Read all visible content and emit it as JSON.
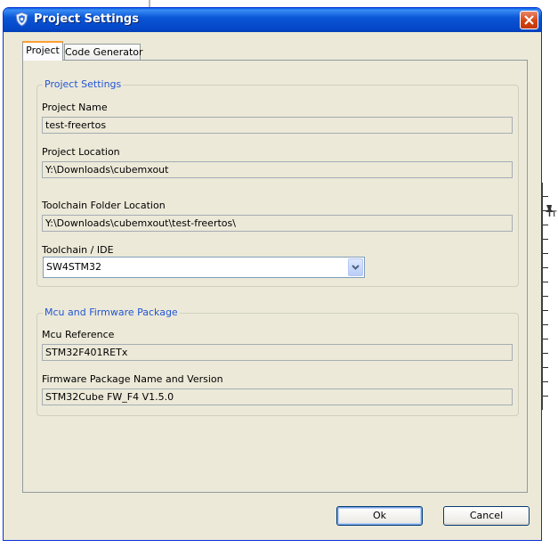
{
  "window": {
    "title": "Project Settings"
  },
  "tabs": [
    {
      "label": "Project",
      "active": true
    },
    {
      "label": "Code Generator",
      "active": false
    }
  ],
  "project_settings": {
    "group_title": "Project Settings",
    "project_name_label": "Project Name",
    "project_name_value": "test-freertos",
    "project_location_label": "Project Location",
    "project_location_value": "Y:\\Downloads\\cubemxout",
    "toolchain_folder_label": "Toolchain Folder Location",
    "toolchain_folder_value": "Y:\\Downloads\\cubemxout\\test-freertos\\",
    "toolchain_ide_label": "Toolchain / IDE",
    "toolchain_ide_value": "SW4STM32"
  },
  "mcu_firmware": {
    "group_title": "Mcu and Firmware Package",
    "mcu_reference_label": "Mcu Reference",
    "mcu_reference_value": "STM32F401RETx",
    "firmware_label": "Firmware Package Name and Version",
    "firmware_value": "STM32Cube FW_F4 V1.5.0"
  },
  "buttons": {
    "ok_label": "Ok",
    "cancel_label": "Cancel"
  },
  "background": {
    "side_letter": "T"
  },
  "colors": {
    "titlebar": "#0a56d6",
    "group_title": "#2255d6",
    "dialog_bg": "#ece9d8",
    "close_button": "#d3410c",
    "active_tab_accent": "#ff9f30"
  },
  "icons": {
    "title": "shield-app-icon",
    "close": "close-icon",
    "dropdown": "chevron-down-icon",
    "pin": "pin-icon"
  }
}
